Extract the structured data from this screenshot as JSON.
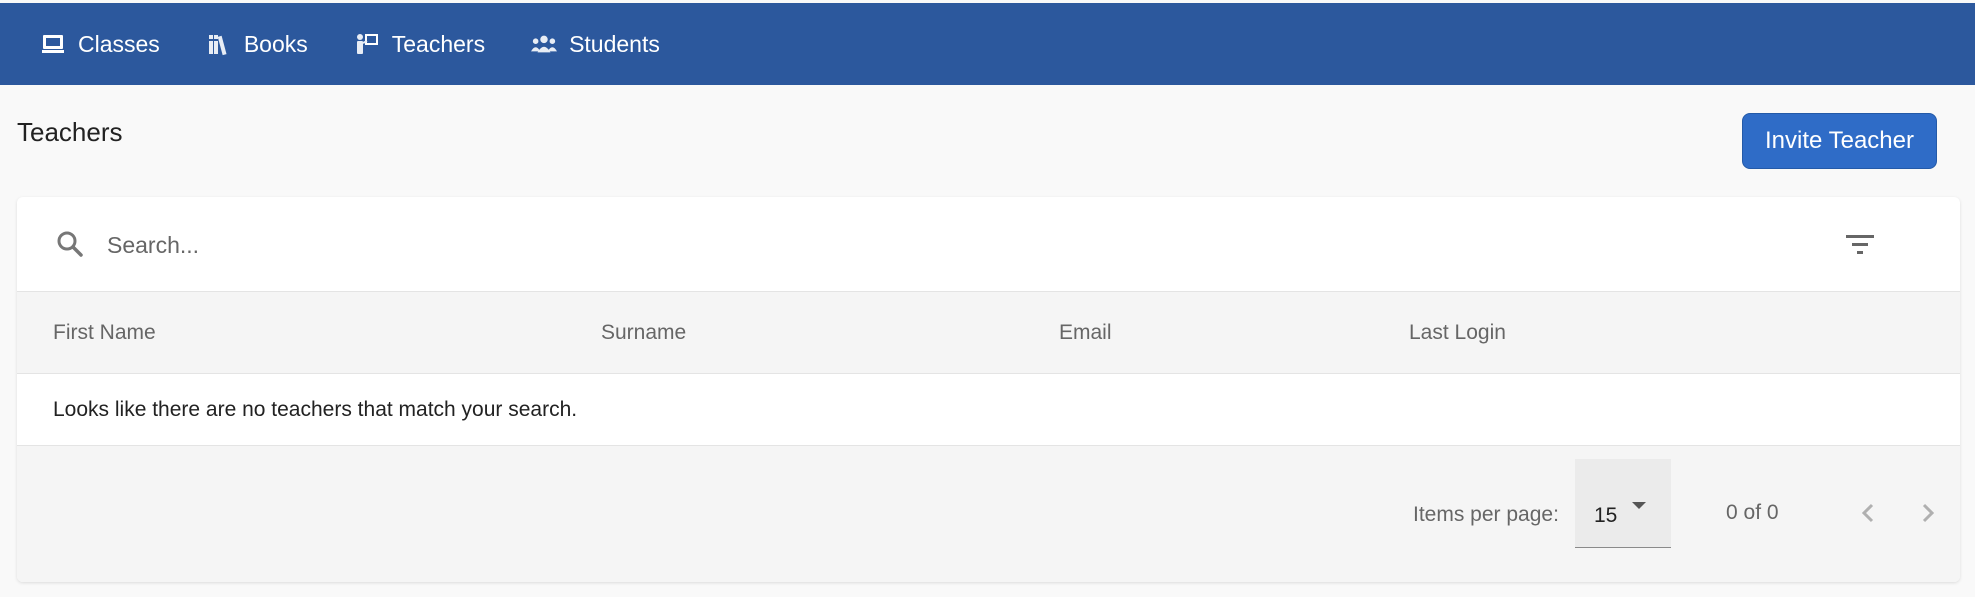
{
  "nav": {
    "items": [
      {
        "label": "Classes",
        "icon": "classroom-icon"
      },
      {
        "label": "Books",
        "icon": "books-icon"
      },
      {
        "label": "Teachers",
        "icon": "teacher-icon"
      },
      {
        "label": "Students",
        "icon": "students-icon"
      }
    ]
  },
  "page": {
    "title": "Teachers",
    "invite_label": "Invite Teacher"
  },
  "search": {
    "placeholder": "Search...",
    "value": ""
  },
  "table": {
    "columns": [
      "First Name",
      "Surname",
      "Email",
      "Last Login"
    ],
    "rows": [],
    "empty_message": "Looks like there are no teachers that match your search."
  },
  "paginator": {
    "items_per_page_label": "Items per page:",
    "items_per_page": "15",
    "range": "0 of 0"
  },
  "colors": {
    "navbar": "#2c589d",
    "accent_button": "#2f6cc7",
    "background": "#f9f9f9"
  }
}
